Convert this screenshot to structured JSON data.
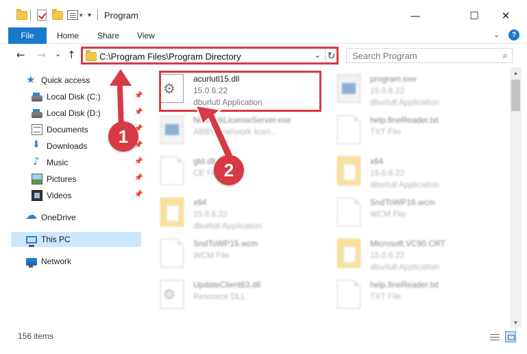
{
  "window": {
    "title": "Program",
    "minimize": "—",
    "maximize": "☐",
    "close": "✕"
  },
  "ribbon": {
    "file": "File",
    "tabs": [
      "Home",
      "Share",
      "View"
    ]
  },
  "nav": {
    "back": "←",
    "forward": "→",
    "recent": "⌄",
    "up": "↑",
    "address": "C:\\Program Files\\Program Directory",
    "dropdown": "⌄",
    "refresh": "↻",
    "search_placeholder": "Search Program",
    "search_icon": "⌕"
  },
  "sidebar": {
    "items": [
      {
        "label": "Quick access",
        "icon": "star-icon",
        "pinned": false
      },
      {
        "label": "Local Disk (C:)",
        "icon": "disk-icon",
        "pinned": true
      },
      {
        "label": "Local Disk (D:)",
        "icon": "disk-icon",
        "pinned": true
      },
      {
        "label": "Documents",
        "icon": "documents-icon",
        "pinned": true
      },
      {
        "label": "Downloads",
        "icon": "downloads-icon",
        "pinned": true
      },
      {
        "label": "Music",
        "icon": "music-icon",
        "pinned": true
      },
      {
        "label": "Pictures",
        "icon": "pictures-icon",
        "pinned": true
      },
      {
        "label": "Videos",
        "icon": "videos-icon",
        "pinned": true
      },
      {
        "label": "OneDrive",
        "icon": "onedrive-icon",
        "pinned": false
      },
      {
        "label": "This PC",
        "icon": "pc-icon",
        "pinned": false,
        "selected": true
      },
      {
        "label": "Network",
        "icon": "network-icon",
        "pinned": false
      }
    ],
    "pin_glyph": "📌"
  },
  "files": [
    {
      "name": "acurlutl15.dll",
      "line1": "15.0.6.22",
      "line2": "dburlutl Application",
      "icon": "dll-icon",
      "highlighted": true
    },
    {
      "name": "program.exe",
      "line1": "15.0.6.22",
      "line2": "dburlutl Application",
      "icon": "exe-icon"
    },
    {
      "name": "NetworkLicenseServer.exe",
      "line1": "ABBYY network licen...",
      "line2": "",
      "icon": "exe-icon"
    },
    {
      "name": "help.fineReader.txt",
      "line1": "TXT File",
      "line2": "",
      "icon": "doc-icon"
    },
    {
      "name": "gtd.dll",
      "line1": "CE File",
      "line2": "",
      "icon": "doc-icon"
    },
    {
      "name": "x64",
      "line1": "15.0.6.22",
      "line2": "dburlutl Application",
      "icon": "folder-icon"
    },
    {
      "name": "x64",
      "line1": "15.0.6.22",
      "line2": "dburlutl Application",
      "icon": "folder-icon"
    },
    {
      "name": "SndToWP16.wcm",
      "line1": "WCM File",
      "line2": "",
      "icon": "doc-icon"
    },
    {
      "name": "SndToWP15.wcm",
      "line1": "WCM File",
      "line2": "",
      "icon": "doc-icon"
    },
    {
      "name": "Microsoft.VC90.CRT",
      "line1": "15.0.6.22",
      "line2": "dburlutl Application",
      "icon": "folder-icon"
    },
    {
      "name": "UpdateClient63.dll",
      "line1": "Resource DLL",
      "line2": "",
      "icon": "dll-icon"
    },
    {
      "name": "help.fineReader.txt",
      "line1": "TXT File",
      "line2": "",
      "icon": "doc-icon"
    }
  ],
  "status": {
    "count": "156 items"
  },
  "annotations": {
    "badge1": "1",
    "badge2": "2"
  },
  "colors": {
    "accent": "#1979ca",
    "highlight_red": "#d63a44",
    "selection": "#cce8ff"
  }
}
